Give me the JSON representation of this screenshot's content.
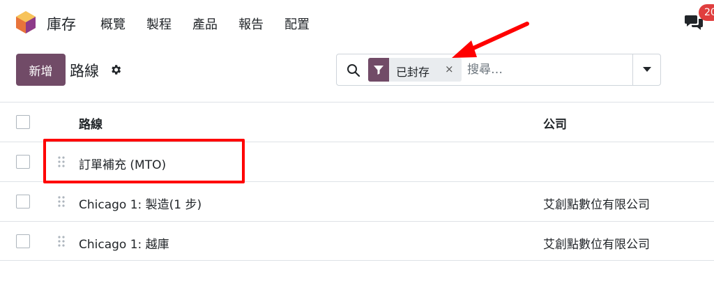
{
  "navbar": {
    "app_name": "庫存",
    "menu": [
      "概覽",
      "製程",
      "產品",
      "報告",
      "配置"
    ],
    "badge_count": "20"
  },
  "control": {
    "new_label": "新增",
    "breadcrumb": "路線"
  },
  "search": {
    "facet_label": "已封存",
    "facet_remove": "×",
    "placeholder": "搜尋…"
  },
  "table": {
    "headers": {
      "name": "路線",
      "company": "公司"
    },
    "rows": [
      {
        "name": "訂單補充 (MTO)",
        "company": ""
      },
      {
        "name": "Chicago 1: 製造(1 步)",
        "company": "艾創點數位有限公司"
      },
      {
        "name": "Chicago 1: 越庫",
        "company": "艾創點數位有限公司"
      }
    ]
  },
  "colors": {
    "brand": "#714b67",
    "annotation": "#ff0000",
    "badge": "#e03e3e"
  }
}
